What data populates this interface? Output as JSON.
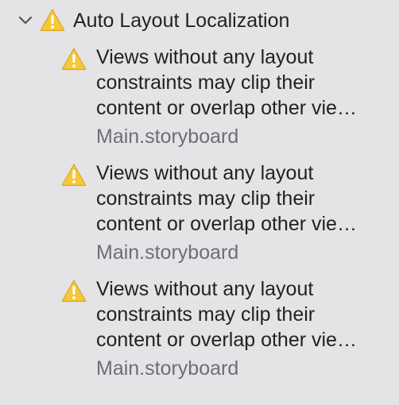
{
  "group": {
    "title": "Auto Layout Localization",
    "expanded": true,
    "icon": "warning-triangle-icon"
  },
  "colors": {
    "background": "#e4e4e7",
    "warning_fill": "#f5c73b",
    "text_primary": "#222222",
    "text_secondary": "#6e6e73"
  },
  "issues": [
    {
      "message_lines": [
        "Views without any layout",
        "constraints may clip their",
        "content or overlap other vie…"
      ],
      "file": "Main.storyboard",
      "icon": "warning-triangle-icon"
    },
    {
      "message_lines": [
        "Views without any layout",
        "constraints may clip their",
        "content or overlap other vie…"
      ],
      "file": "Main.storyboard",
      "icon": "warning-triangle-icon"
    },
    {
      "message_lines": [
        "Views without any layout",
        "constraints may clip their",
        "content or overlap other vie…"
      ],
      "file": "Main.storyboard",
      "icon": "warning-triangle-icon"
    }
  ]
}
